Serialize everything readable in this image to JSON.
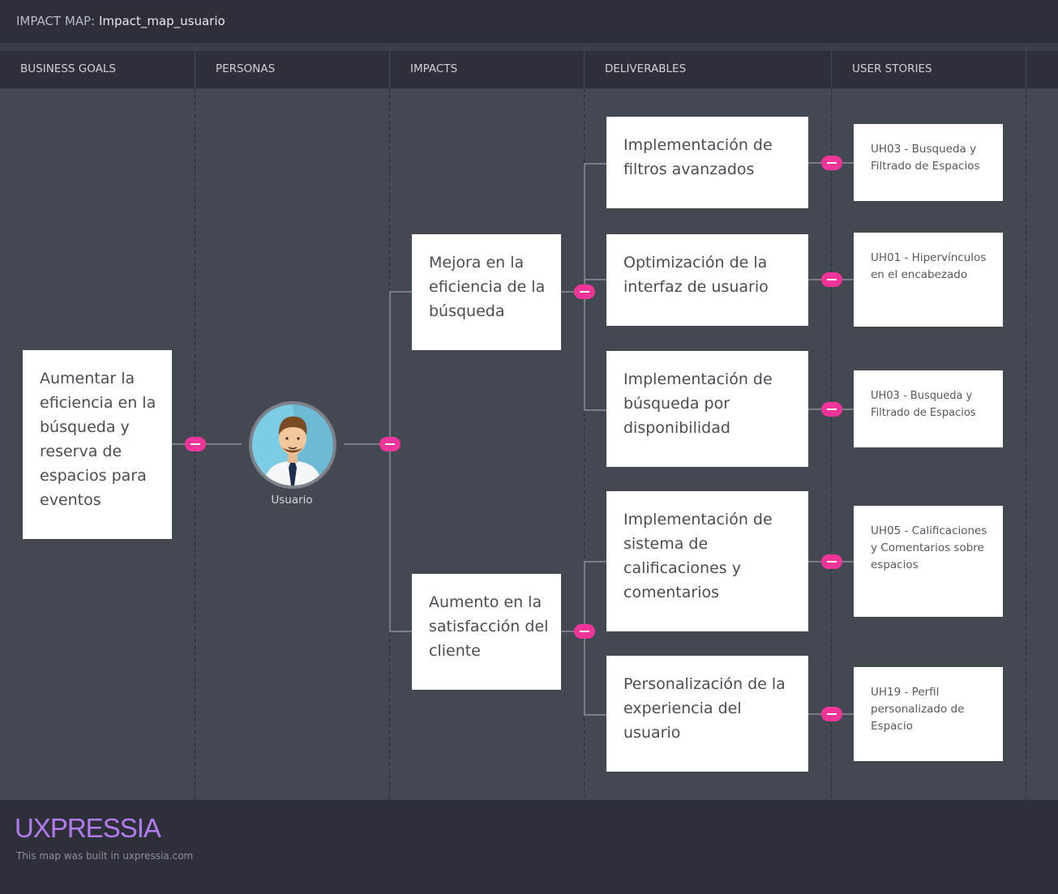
{
  "header": {
    "prefix": "IMPACT MAP:",
    "map_name": "Impact_map_usuario"
  },
  "columns": [
    "BUSINESS GOALS",
    "PERSONAS",
    "IMPACTS",
    "DELIVERABLES",
    "USER STORIES"
  ],
  "goal": {
    "text": "Aumentar la eficiencia en la búsqueda y reserva de espacios para eventos"
  },
  "persona": {
    "name": "Usuario"
  },
  "impacts": [
    {
      "text": "Mejora en la eficiencia de la búsqueda"
    },
    {
      "text": "Aumento en la satisfacción del cliente"
    }
  ],
  "deliverables": [
    {
      "text": "Implementación de filtros avanzados"
    },
    {
      "text": "Optimización de la interfaz de usuario"
    },
    {
      "text": "Implementación de búsqueda por disponibilidad"
    },
    {
      "text": "Implementación de sistema de calificaciones y comentarios"
    },
    {
      "text": "Personalización de la experiencia del usuario"
    }
  ],
  "stories": [
    {
      "text": "UH03 - Busqueda y Filtrado de Espacios"
    },
    {
      "text": "UH01 - Hipervínculos en el encabezado"
    },
    {
      "text": "UH03 - Busqueda y Filtrado de Espacios"
    },
    {
      "text": "UH05 - Calificaciones y Comentarios sobre espacios"
    },
    {
      "text": "UH19 - Perfil personalizado de Espacio"
    }
  ],
  "footer": {
    "logo": "UXPRESSIA",
    "credit": "This map was built in uxpressia.com"
  },
  "colors": {
    "accent": "#f0359a",
    "logo": "#b37bf0",
    "background": "#434851",
    "bar": "#2e3039"
  }
}
